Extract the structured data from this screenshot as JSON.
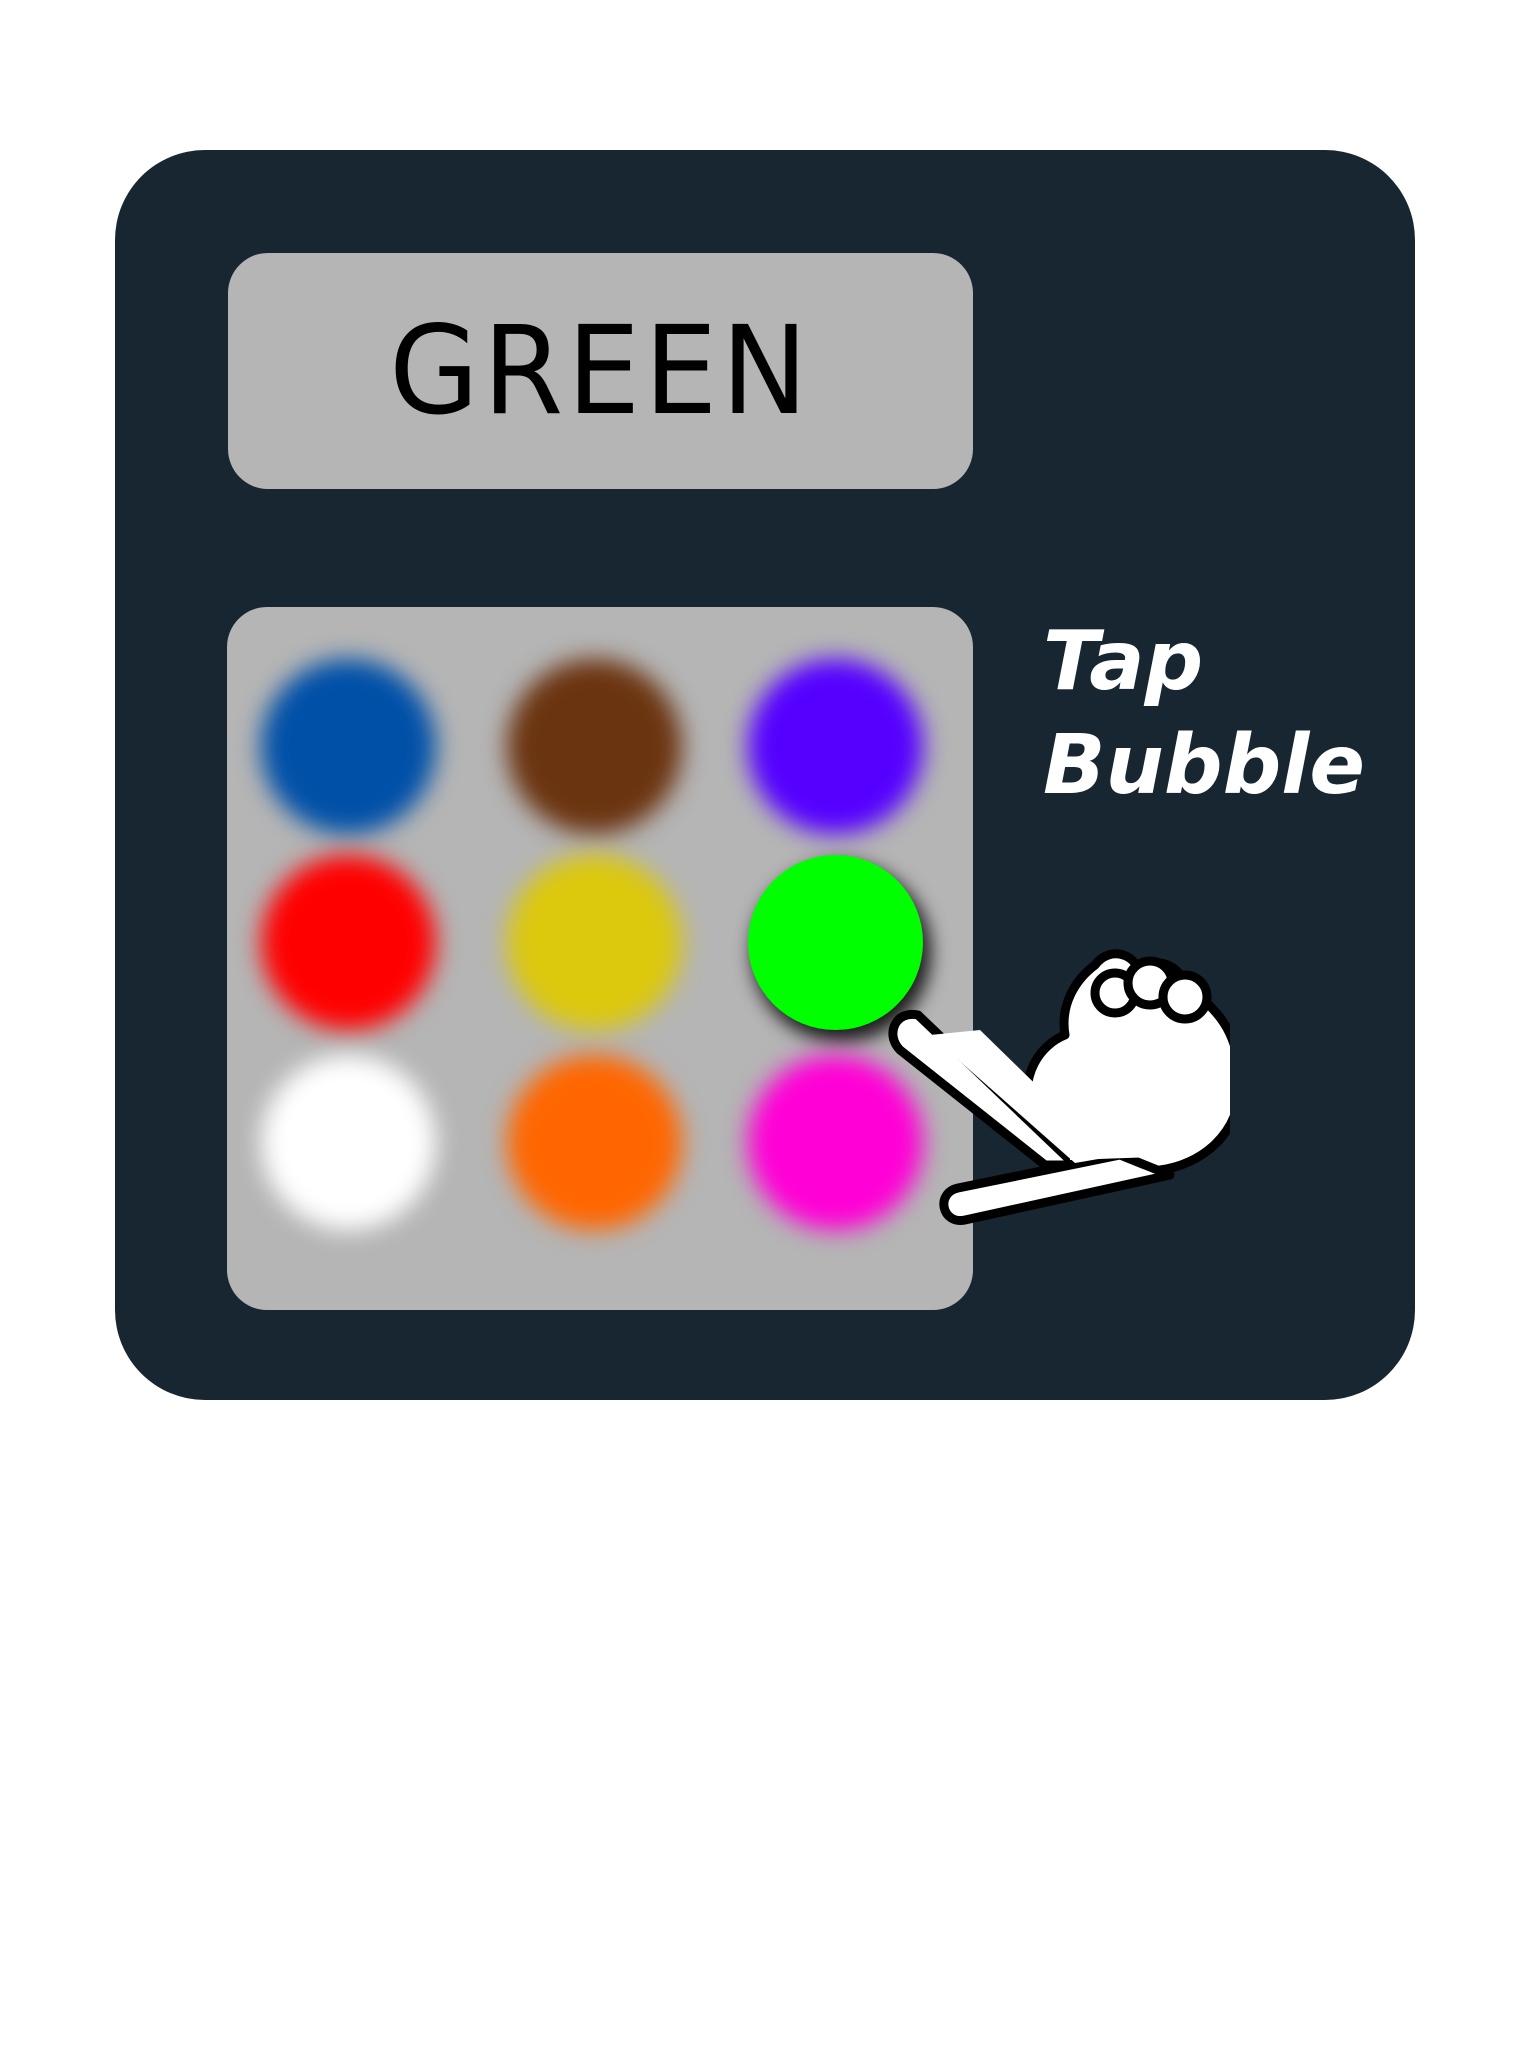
{
  "target_word": "GREEN",
  "hint": {
    "line1": "Tap",
    "line2": "Bubble"
  },
  "hand_icon": "pointing-hand-icon",
  "bubbles": [
    {
      "name": "blue",
      "color": "#0050a8",
      "state": "blurred"
    },
    {
      "name": "brown",
      "color": "#6b3410",
      "state": "blurred"
    },
    {
      "name": "purple",
      "color": "#5500ff",
      "state": "blurred"
    },
    {
      "name": "red",
      "color": "#ff0000",
      "state": "blurred"
    },
    {
      "name": "yellow",
      "color": "#dcc80c",
      "state": "blurred"
    },
    {
      "name": "green",
      "color": "#00ff00",
      "state": "active"
    },
    {
      "name": "white",
      "color": "#ffffff",
      "state": "blurred"
    },
    {
      "name": "orange",
      "color": "#ff6600",
      "state": "blurred"
    },
    {
      "name": "magenta",
      "color": "#ff00d6",
      "state": "blurred"
    }
  ],
  "colors": {
    "panel": "#172631",
    "box": "#b5b5b5"
  }
}
